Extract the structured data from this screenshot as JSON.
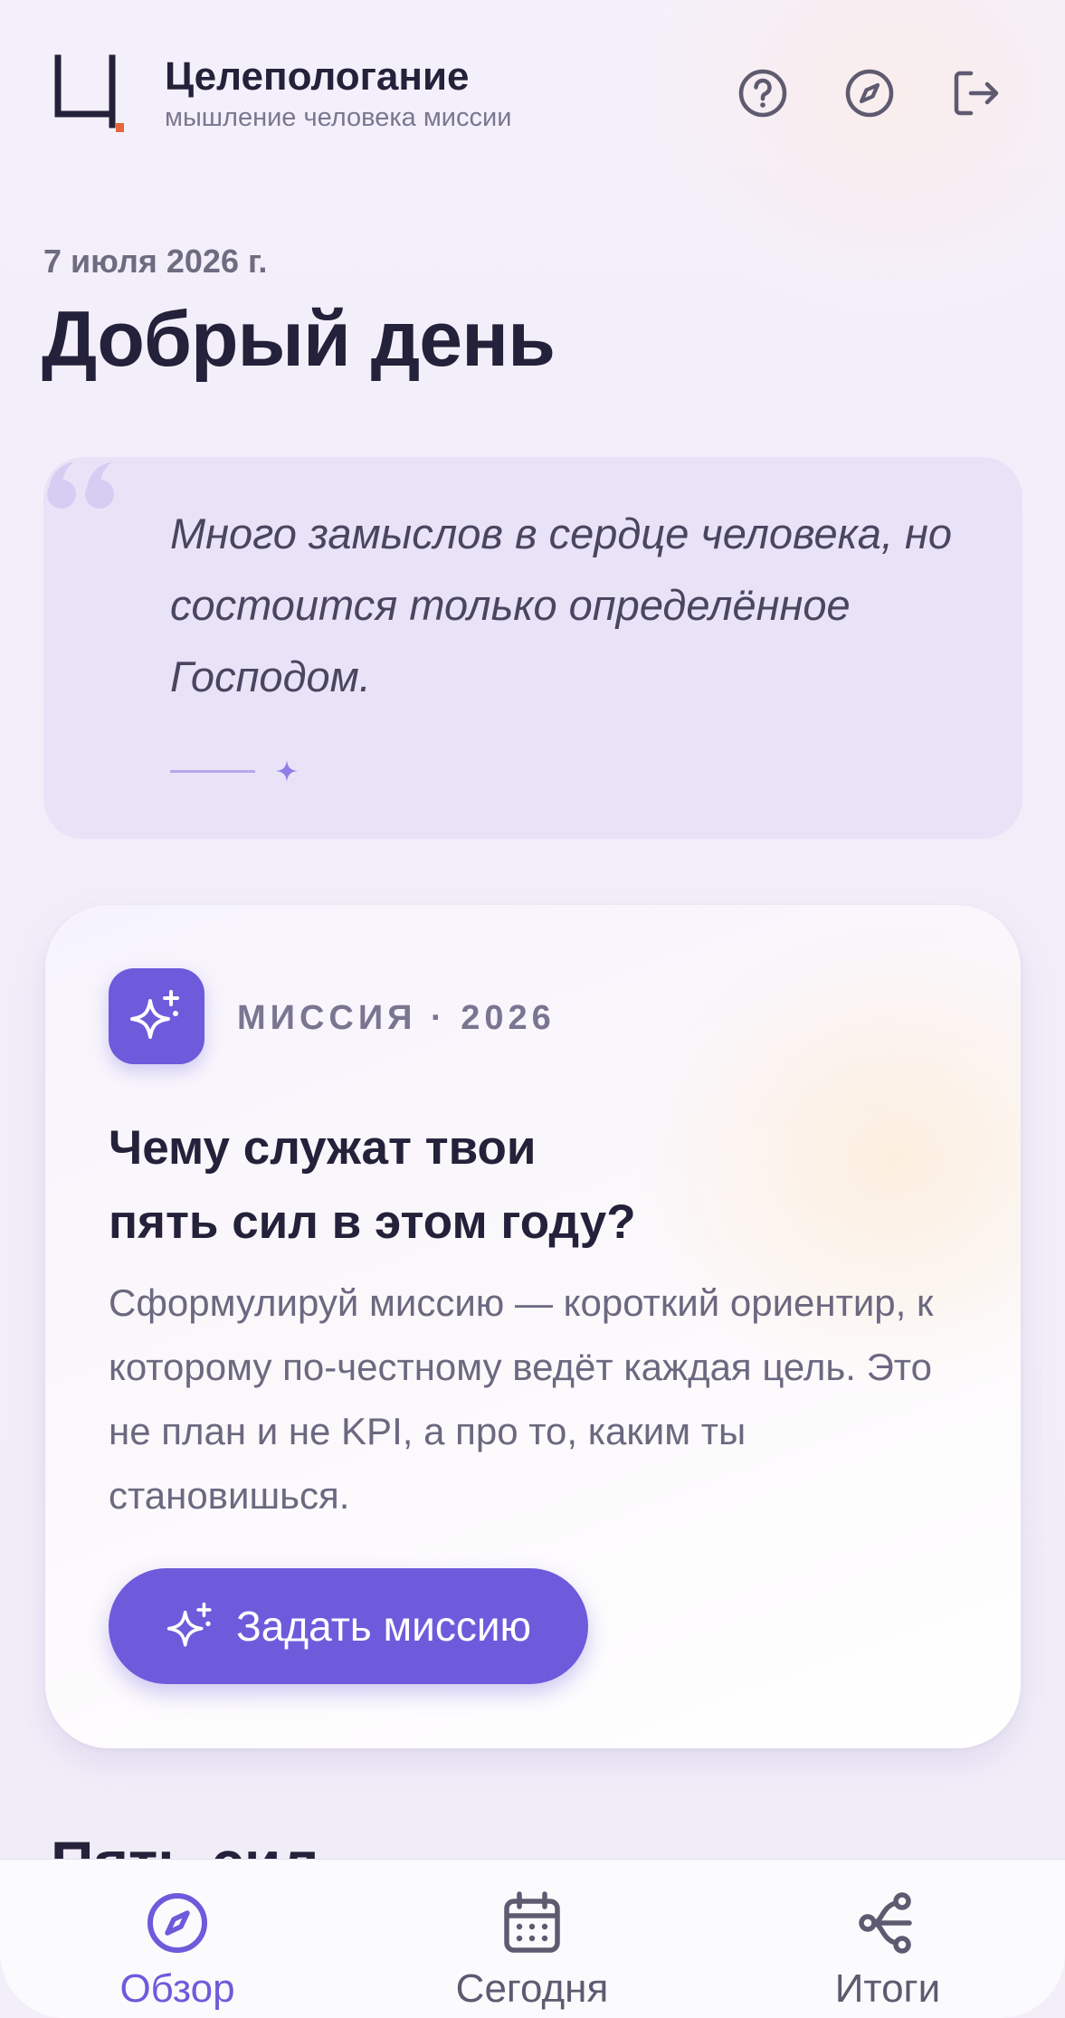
{
  "header": {
    "app_title": "Целепологание",
    "app_subtitle": "мышление человека миссии",
    "icons": [
      "help-icon",
      "compass-icon",
      "logout-icon"
    ]
  },
  "greeting": {
    "date": "7 июля 2026 г.",
    "title": "Добрый день"
  },
  "quote": {
    "text": "Много замыслов в сердце человека, но состоится только определённое Господом."
  },
  "mission": {
    "kicker": "МИССИЯ · 2026",
    "title_line1": "Чему служат твои",
    "title_line2": "пять сил в этом году?",
    "description": "Сформулируй миссию — короткий ориентир, к которому по-честному ведёт каждая цель. Это не план и не KPI, а про то, каким ты становишься.",
    "button_label": "Задать миссию"
  },
  "next_section_title": "Пять сил",
  "nav": {
    "items": [
      {
        "label": "Обзор",
        "icon": "compass-icon",
        "active": true
      },
      {
        "label": "Сегодня",
        "icon": "calendar-icon",
        "active": false
      },
      {
        "label": "Итоги",
        "icon": "path-icon",
        "active": false
      }
    ]
  },
  "colors": {
    "accent": "#6d5bdc",
    "text": "#24213a",
    "muted": "#6c6880",
    "quote_bg": "#e9e3f8"
  }
}
